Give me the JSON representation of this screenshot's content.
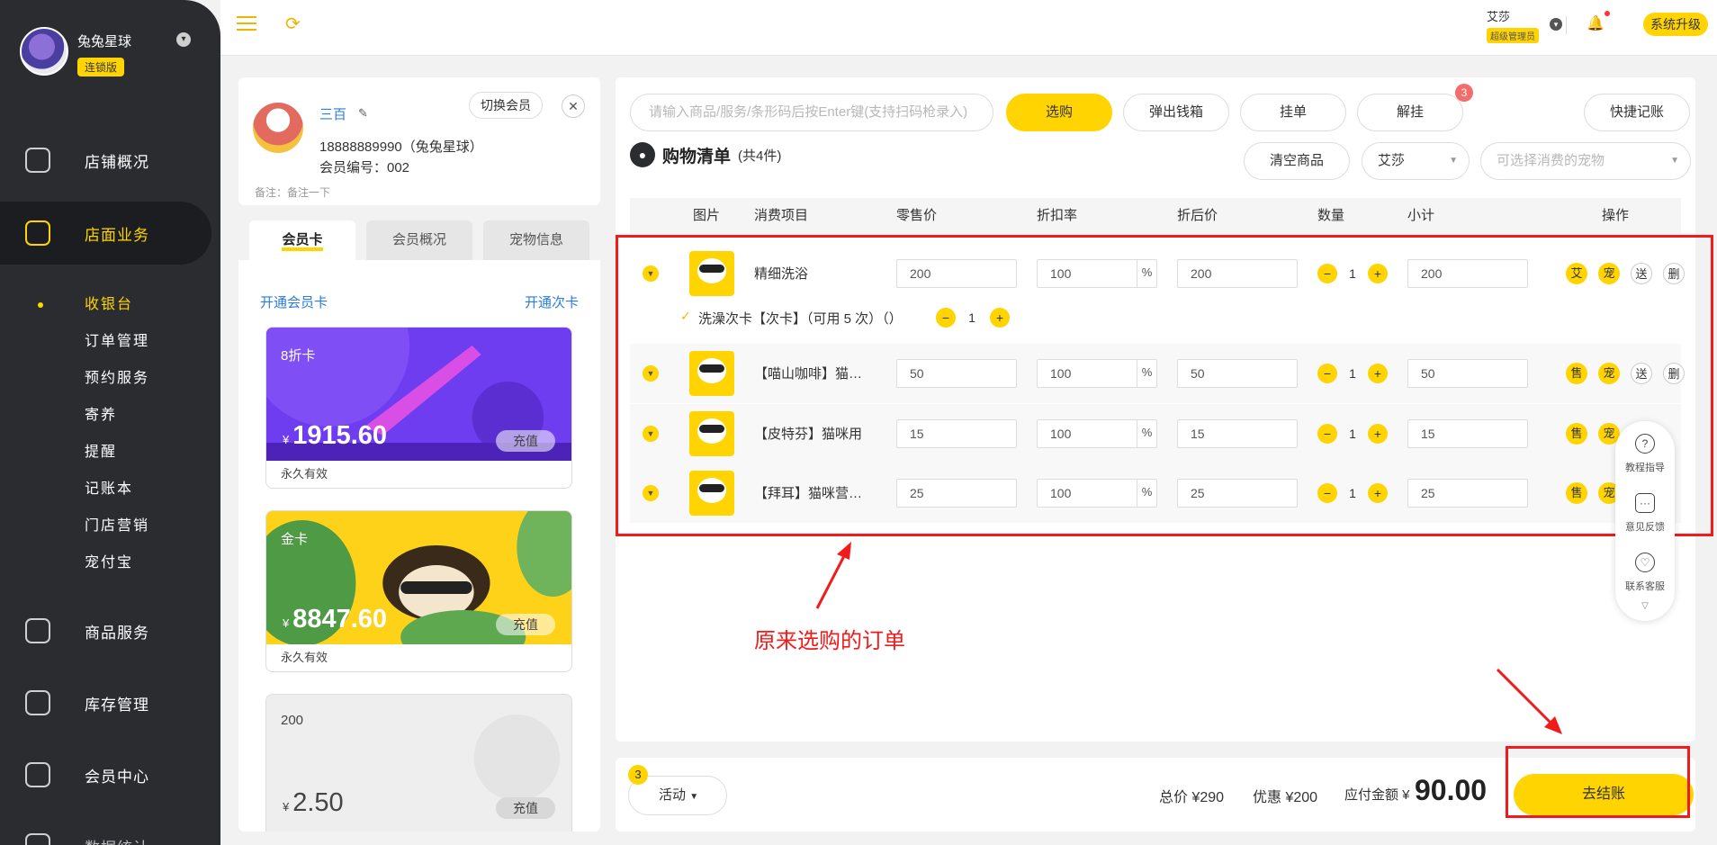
{
  "brand": {
    "name": "兔兔星球",
    "tag": "连锁版"
  },
  "nav": {
    "main": [
      "店铺概况",
      "店面业务",
      "商品服务",
      "库存管理",
      "会员中心",
      "数据统计"
    ],
    "sub": [
      "收银台",
      "订单管理",
      "预约服务",
      "寄养",
      "提醒",
      "记账本",
      "门店营销",
      "宠付宝"
    ]
  },
  "topbar": {
    "user_name": "艾莎",
    "user_role": "超级管理员",
    "upgrade": "系统升级"
  },
  "member": {
    "name": "三百",
    "phone": "18888889990（兔兔星球）",
    "member_no": "会员编号：002",
    "note": "备注：备注一下",
    "switch_label": "切换会员",
    "close_label": "✕",
    "tabs": [
      "会员卡",
      "会员概况",
      "宠物信息"
    ],
    "open_card": "开通会员卡",
    "open_times": "开通次卡",
    "cards": [
      {
        "name": "8折卡",
        "currency": "¥",
        "amount": "1915.60",
        "recharge": "充值",
        "valid": "永久有效"
      },
      {
        "name": "金卡",
        "currency": "¥",
        "amount": "8847.60",
        "recharge": "充值",
        "valid": "永久有效"
      },
      {
        "name": "200",
        "currency": "¥",
        "amount": "2.50",
        "recharge": "充值"
      }
    ]
  },
  "toolbar": {
    "search_placeholder": "请输入商品/服务/条形码后按Enter键(支持扫码枪录入)",
    "select_btn": "选购",
    "cashbox": "弹出钱箱",
    "hold": "挂单",
    "unhold": "解挂",
    "unhold_badge": "3",
    "quick_note": "快捷记账"
  },
  "cart": {
    "title": "购物清单",
    "count": "(共4件)",
    "clear": "清空商品",
    "staff": "艾莎",
    "pet_placeholder": "可选择消费的宠物",
    "headers": [
      "图片",
      "消费项目",
      "零售价",
      "折扣率",
      "折后价",
      "数量",
      "小计",
      "操作"
    ],
    "percent": "%",
    "rows": [
      {
        "name": "精细洗浴",
        "price": "200",
        "discount": "100",
        "after": "200",
        "qty": "1",
        "subtotal": "200",
        "ops": [
          "艾",
          "宠",
          "送",
          "删"
        ]
      },
      {
        "name": "【喵山咖啡】猫…",
        "price": "50",
        "discount": "100",
        "after": "50",
        "qty": "1",
        "subtotal": "50",
        "ops": [
          "售",
          "宠",
          "送",
          "删"
        ]
      },
      {
        "name": "【皮特芬】猫咪用",
        "price": "15",
        "discount": "100",
        "after": "15",
        "qty": "1",
        "subtotal": "15",
        "ops": [
          "售",
          "宠"
        ]
      },
      {
        "name": "【拜耳】猫咪营…",
        "price": "25",
        "discount": "100",
        "after": "25",
        "qty": "1",
        "subtotal": "25",
        "ops": [
          "售",
          "宠"
        ]
      }
    ],
    "sub_row": {
      "text": "洗澡次卡【次卡】（可用 5 次）（）",
      "qty": "1"
    }
  },
  "annotation": "原来选购的订单",
  "help": {
    "items": [
      "教程指导",
      "意见反馈",
      "联系客服"
    ]
  },
  "bottom": {
    "activity": "活动",
    "activity_badge": "3",
    "total": "总价 ¥290",
    "discount": "优惠 ¥200",
    "payable_label": "应付金额 ¥",
    "payable": "90.00",
    "checkout": "去结账"
  },
  "colors": {
    "accent": "#ffd400",
    "sidebar": "#2b2c30",
    "link": "#2a7ce0",
    "annotation": "#f21b1b"
  }
}
